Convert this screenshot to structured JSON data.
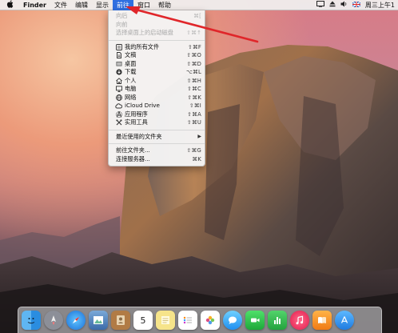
{
  "menubar": {
    "apple_glyph": "",
    "app_name": "Finder",
    "menus": [
      "文件",
      "编辑",
      "显示",
      "前往",
      "窗口",
      "帮助"
    ],
    "active_menu": "前往",
    "status": {
      "input_source": "A",
      "clock": "周三上午1"
    }
  },
  "go_menu": {
    "items_top": [
      {
        "label": "向后",
        "shortcut": "⌘[",
        "disabled": true
      },
      {
        "label": "向前",
        "shortcut": "",
        "disabled": true
      },
      {
        "label": "选择桌面上的启动磁盘",
        "shortcut": "⇧⌘↑",
        "disabled": true
      }
    ],
    "items_places": [
      {
        "icon": "all-files-icon",
        "label": "我的所有文件",
        "shortcut": "⇧⌘F"
      },
      {
        "icon": "documents-icon",
        "label": "文稿",
        "shortcut": "⇧⌘O"
      },
      {
        "icon": "desktop-icon",
        "label": "桌面",
        "shortcut": "⇧⌘D"
      },
      {
        "icon": "downloads-icon",
        "label": "下载",
        "shortcut": "⌥⌘L"
      },
      {
        "icon": "home-icon",
        "label": "个人",
        "shortcut": "⇧⌘H"
      },
      {
        "icon": "computer-icon",
        "label": "电脑",
        "shortcut": "⇧⌘C"
      },
      {
        "icon": "network-icon",
        "label": "网络",
        "shortcut": "⇧⌘K"
      },
      {
        "icon": "icloud-icon",
        "label": "iCloud Drive",
        "shortcut": "⇧⌘I"
      },
      {
        "icon": "applications-icon",
        "label": "应用程序",
        "shortcut": "⇧⌘A"
      },
      {
        "icon": "utilities-icon",
        "label": "实用工具",
        "shortcut": "⇧⌘U"
      }
    ],
    "recent_folders": {
      "label": "最近使用的文件夹",
      "submenu_arrow": "▶"
    },
    "items_bottom": [
      {
        "label": "前往文件夹...",
        "shortcut": "⇧⌘G"
      },
      {
        "label": "连接服务器...",
        "shortcut": "⌘K"
      }
    ]
  },
  "dock": {
    "calendar": {
      "month": "",
      "day": "5"
    },
    "apps": [
      "finder-icon",
      "launchpad-icon",
      "safari-icon",
      "preview-icon",
      "contacts-icon",
      "calendar-icon",
      "notes-icon",
      "reminders-icon",
      "photos-icon",
      "messages-icon",
      "facetime-icon",
      "numbers-icon",
      "itunes-icon",
      "ibooks-icon",
      "app-store-icon"
    ]
  },
  "colors": {
    "menu_highlight": "#2f6fe0",
    "annotation_arrow": "#e0262a"
  }
}
